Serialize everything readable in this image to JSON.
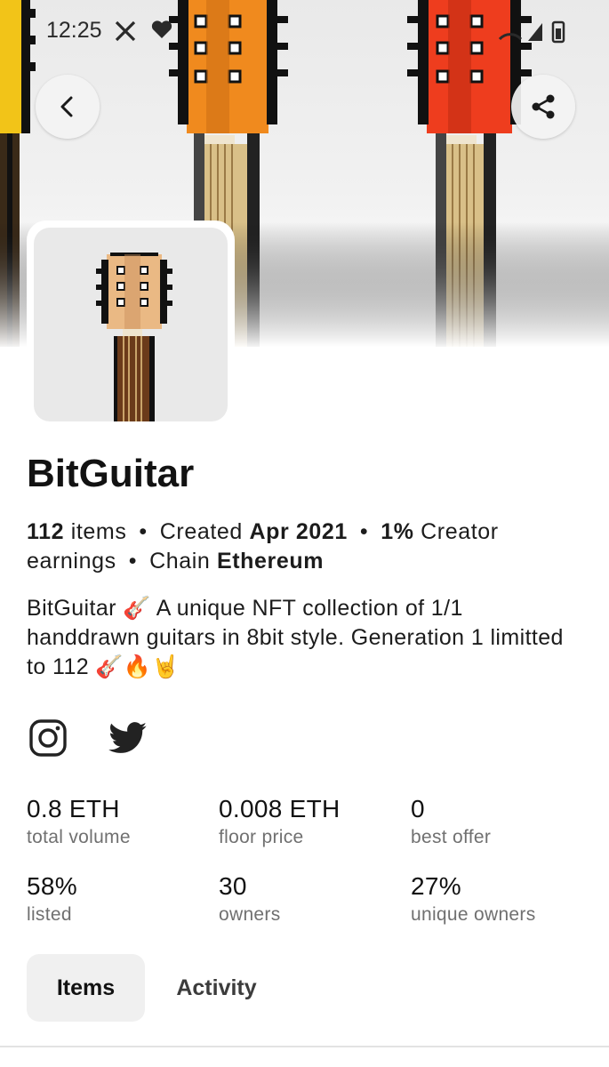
{
  "status_bar": {
    "time": "12:25"
  },
  "collection": {
    "name": "BitGuitar",
    "items_count": "112",
    "items_label": "items",
    "created_label": "Created",
    "created_date": "Apr 2021",
    "creator_earnings_value": "1%",
    "creator_earnings_label": "Creator earnings",
    "chain_label": "Chain",
    "chain_value": "Ethereum",
    "description": "BitGuitar 🎸  A unique NFT collection of 1/1 handdrawn guitars in 8bit style. Generation 1 limitted to 112 🎸🔥🤘"
  },
  "stats": [
    {
      "value": "0.8 ETH",
      "label": "total volume"
    },
    {
      "value": "0.008 ETH",
      "label": "floor price"
    },
    {
      "value": "0",
      "label": "best offer"
    },
    {
      "value": "58%",
      "label": "listed"
    },
    {
      "value": "30",
      "label": "owners"
    },
    {
      "value": "27%",
      "label": "unique owners"
    }
  ],
  "tabs": [
    {
      "label": "Items",
      "active": true
    },
    {
      "label": "Activity",
      "active": false
    }
  ],
  "icons": {
    "back": "chevron-left-icon",
    "share": "share-icon",
    "instagram": "instagram-icon",
    "twitter": "twitter-icon"
  },
  "colors": {
    "guitar_yellow": "#f2c418",
    "guitar_orange": "#f08a1e",
    "guitar_red": "#ee3d1e",
    "avatar_headstock": "#eab984",
    "active_tab_bg": "#f0f0f0",
    "label_gray": "#707070"
  }
}
